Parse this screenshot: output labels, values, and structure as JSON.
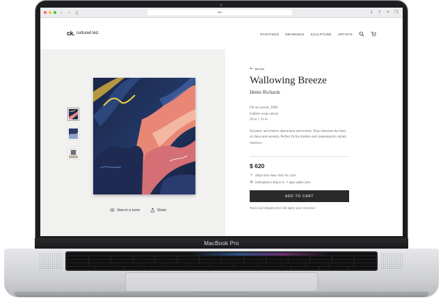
{
  "device": {
    "label": "MacBook Pro"
  },
  "browser": {
    "url": "Wix"
  },
  "site": {
    "logo_mark": "ck.",
    "logo_text": "cultured kid.",
    "nav": [
      "PAINTINGS",
      "DRAWINGS",
      "SCULPTURE",
      "ARTISTS"
    ],
    "icons": {
      "search": "search-icon",
      "cart": "cart-icon"
    }
  },
  "gallery": {
    "view_in_room": "View in a room",
    "share": "Share"
  },
  "product": {
    "back": "BACK",
    "title": "Wallowing Breeze",
    "artist": "Hettie Richards",
    "specs": [
      "Oil on canvas, 2008",
      "Gallery wrap canvas",
      "26 in × 23 in"
    ],
    "description": "Dynamic and elusive abstraction and texture. Plays between the lines of chaos and serenity. Perfect fit for modern and contemporary styled interiors.",
    "price": "$ 620",
    "ships_from": "Ships from New York, NY, USA",
    "estimated": "Estimated to ship in 3 - 7 days within USA",
    "add_to_cart": "ADD TO CART",
    "taxes_note": "Taxes and shipping fees will apply upon checkout"
  }
}
